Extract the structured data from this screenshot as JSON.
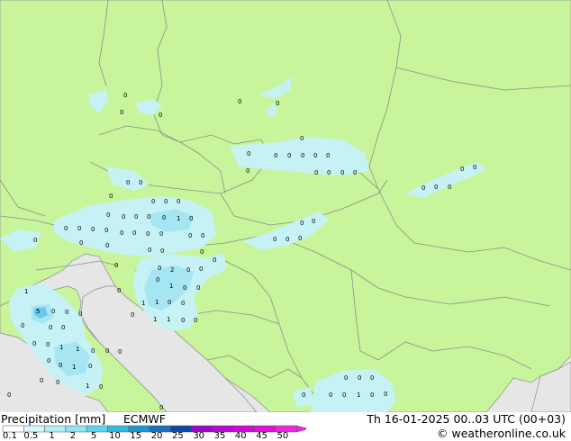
{
  "footer": {
    "title": "Precipitation [mm]",
    "model": "ECMWF",
    "valid_time": "Th 16-01-2025 00..03 UTC (00+03)",
    "credit": "© weatheronline.co.uk"
  },
  "legend": {
    "labels": [
      "0.1",
      "0.5",
      "1",
      "2",
      "5",
      "10",
      "15",
      "20",
      "25",
      "30",
      "35",
      "40",
      "45",
      "50"
    ],
    "colors": [
      "#ffffff",
      "#d8f6fb",
      "#b6eef8",
      "#8fe3f3",
      "#5fd3ea",
      "#36b8de",
      "#1c98cf",
      "#1570bf",
      "#0f46a8",
      "#9a08c8",
      "#b808d0",
      "#d208d6",
      "#e210d8",
      "#f024e0"
    ]
  },
  "map_colors": {
    "sea": "#e6e6e6",
    "land": "#c8f59c",
    "precip_light": "#c6f2f6",
    "precip_mid": "#a6e6f2",
    "precip_heavy": "#66c8ea",
    "border": "#8c8c8c"
  },
  "cell_values": [
    "0",
    "1",
    "2",
    "5"
  ]
}
